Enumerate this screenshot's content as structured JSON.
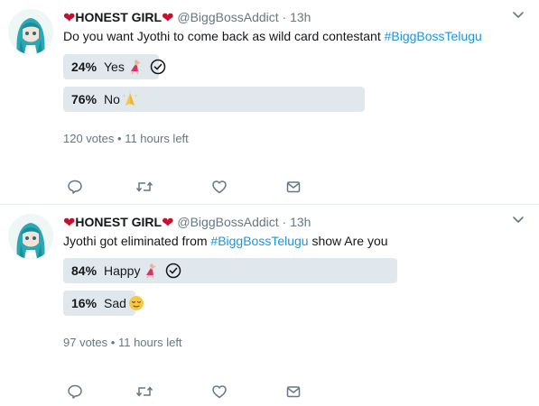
{
  "tweets": [
    {
      "author": {
        "heart_left": "❤",
        "name": "HONEST GIRL",
        "heart_right": "❤",
        "handle": "@BiggBossAddict",
        "dot": "·",
        "time": "13h"
      },
      "text_before": "Do you want Jyothi to come back as wild card contestant ",
      "hashtag": "#BiggBossTelugu",
      "text_after": "",
      "poll": {
        "choices": [
          {
            "percent": "24%",
            "label": "Yes",
            "value": 24,
            "emoji": "dancer",
            "winner": true
          },
          {
            "percent": "76%",
            "label": "No",
            "value": 76,
            "emoji": "folded-hands",
            "winner": false
          }
        ],
        "votes": "120 votes",
        "separator": "•",
        "time_left": "11 hours left"
      },
      "actions": [
        "reply-icon",
        "retweet-icon",
        "like-icon",
        "message-icon"
      ]
    },
    {
      "author": {
        "heart_left": "❤",
        "name": "HONEST GIRL",
        "heart_right": "❤",
        "handle": "@BiggBossAddict",
        "dot": "·",
        "time": "13h"
      },
      "text_before": "Jyothi got eliminated from ",
      "hashtag": "#BiggBossTelugu",
      "text_after": " show Are you",
      "poll": {
        "choices": [
          {
            "percent": "84%",
            "label": "Happy",
            "value": 84,
            "emoji": "dancer",
            "winner": true
          },
          {
            "percent": "16%",
            "label": "Sad",
            "value": 16,
            "emoji": "relieved-face",
            "winner": false
          }
        ],
        "votes": "97 votes",
        "separator": "•",
        "time_left": "11 hours left"
      },
      "actions": [
        "reply-icon",
        "retweet-icon",
        "like-icon",
        "message-icon"
      ]
    }
  ],
  "colors": {
    "hashtag": "#1b95e0",
    "muted": "#657786",
    "heart": "#c8102e",
    "poll_bar": "#e1e8ed"
  }
}
